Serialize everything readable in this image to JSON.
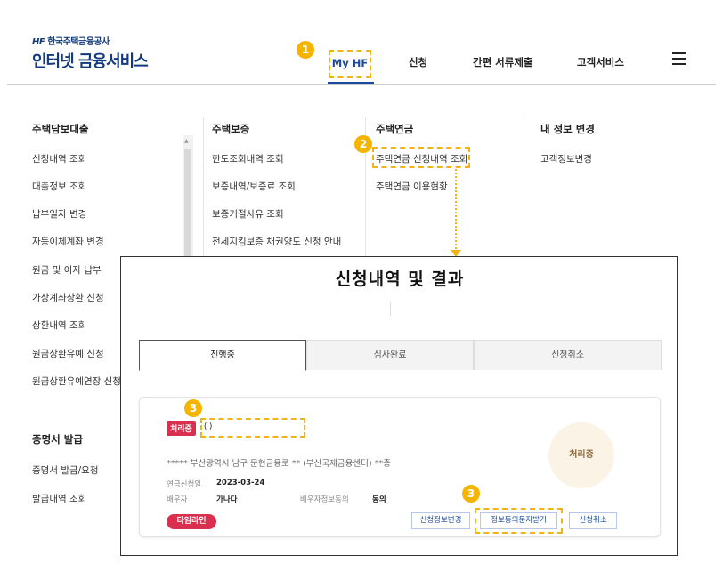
{
  "header": {
    "logo_small": "한국주택금융공사",
    "logo_mark": "HF",
    "logo_big": "인터넷 금융서비스",
    "nav": [
      "My HF",
      "신청",
      "간편 서류제출",
      "고객서비스"
    ]
  },
  "badges": [
    "1",
    "2",
    "3",
    "3"
  ],
  "columns": [
    {
      "title": "주택담보대출",
      "items": [
        "신청내역 조회",
        "대출정보 조회",
        "납부일자 변경",
        "자동이체계좌 변경",
        "원금 및 이자 납부",
        "가상계좌상환 신청",
        "상환내역 조회",
        "원금상환유예 신청",
        "원금상환유예연장 신청"
      ]
    },
    {
      "title": "주택보증",
      "items": [
        "한도조회내역 조회",
        "보증내역/보증료 조회",
        "보증거절사유 조회",
        "전세지킴보증 채권양도 신청 안내"
      ]
    },
    {
      "title": "주택연금",
      "items": [
        "주택연금 신청내역 조회",
        "주택연금 이용현황"
      ]
    },
    {
      "title": "내 정보 변경",
      "items": [
        "고객정보변경"
      ]
    }
  ],
  "certificates": {
    "title": "증명서 발급",
    "items": [
      "증명서 발급/요청",
      "발급내역 조회"
    ]
  },
  "popup": {
    "title": "신청내역 및 결과",
    "tabs": [
      "진행중",
      "심사완료",
      "신청취소"
    ],
    "card": {
      "status_tag": "처리중",
      "name_field": "(                         )",
      "address": "***** 부산광역시 남구 문현금융로 ** (부산국제금융센터) **층",
      "apply_date_label": "연금신청일",
      "apply_date": "2023-03-24",
      "spouse_label": "배우자",
      "spouse_value": "가나다",
      "consent_label": "배우자정보동의",
      "consent_value": "동의",
      "status_circle": "처리중",
      "timeline_button": "타임라인",
      "buttons": [
        "신청정보변경",
        "정보동의문자받기",
        "신청취소"
      ]
    }
  },
  "colors": {
    "brand_blue": "#1b4a9c",
    "highlight_yellow": "#f0b419",
    "status_red": "#d9304f"
  }
}
